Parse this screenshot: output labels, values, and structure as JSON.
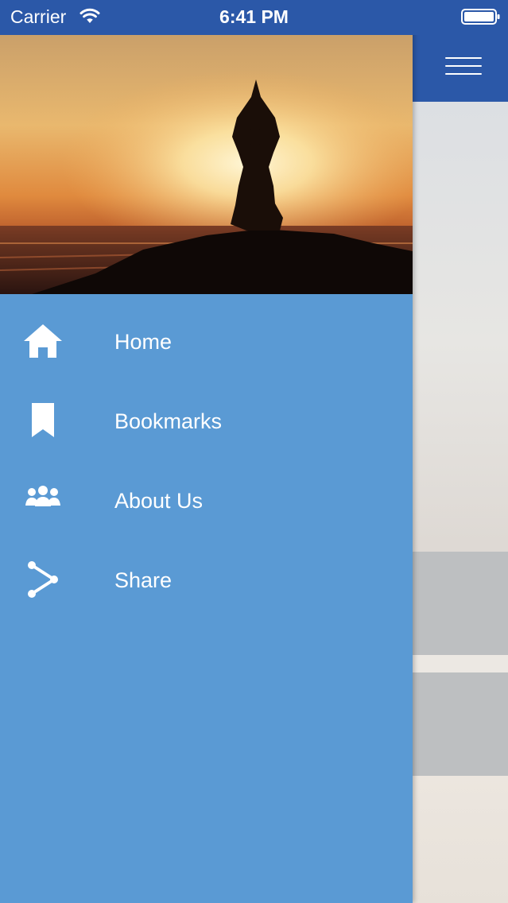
{
  "status_bar": {
    "carrier": "Carrier",
    "time": "6:41 PM",
    "icons": [
      "wifi-icon",
      "battery-icon"
    ]
  },
  "header": {
    "menu_icon": "hamburger-menu-icon",
    "color": "#2b58a8"
  },
  "drawer": {
    "background": "#5a9ad4",
    "hero_image": "yoga-silhouette-sunset",
    "items": [
      {
        "label": "Home",
        "icon": "home-icon"
      },
      {
        "label": "Bookmarks",
        "icon": "bookmark-icon"
      },
      {
        "label": "About Us",
        "icon": "group-icon"
      },
      {
        "label": "Share",
        "icon": "share-icon"
      }
    ]
  }
}
